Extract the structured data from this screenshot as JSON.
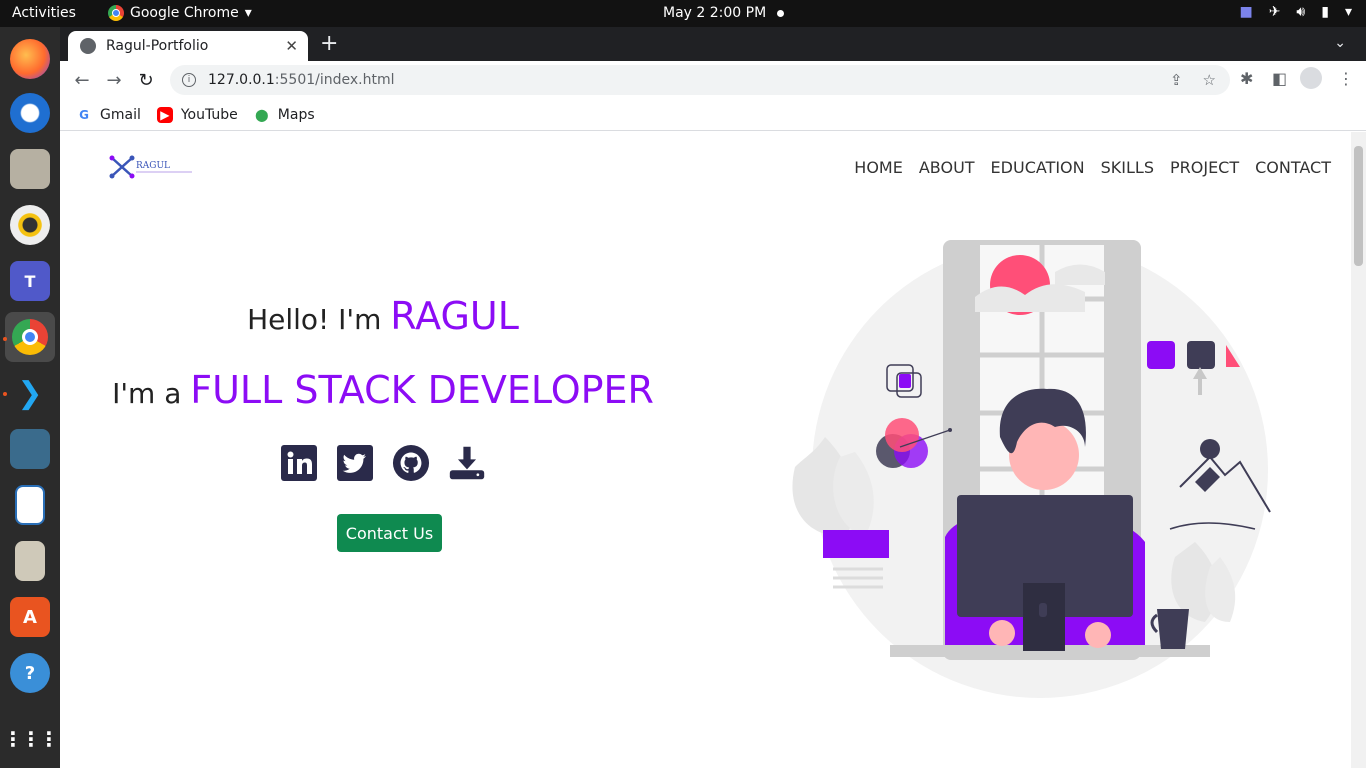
{
  "system": {
    "activities_label": "Activities",
    "app_menu_label": "Google Chrome",
    "clock": "May 2   2:00 PM"
  },
  "browser": {
    "tab_title": "Ragul-Portfolio",
    "url_host": "127.0.0.1",
    "url_rest": ":5501/index.html",
    "bookmarks": [
      "Gmail",
      "YouTube",
      "Maps"
    ]
  },
  "site": {
    "logo_text": "RAGUL",
    "nav": [
      "HOME",
      "ABOUT",
      "EDUCATION",
      "SKILLS",
      "PROJECT",
      "CONTACT"
    ],
    "hello_prefix": "Hello! I'm ",
    "name": "RAGUL",
    "role_prefix": "I'm a ",
    "role": "FULL STACK DEVELOPER",
    "contact_button": "Contact Us",
    "accent_color": "#8c0cf5",
    "button_color": "#0f8a50",
    "socials": [
      "linkedin-icon",
      "twitter-icon",
      "github-icon",
      "download-icon"
    ]
  }
}
